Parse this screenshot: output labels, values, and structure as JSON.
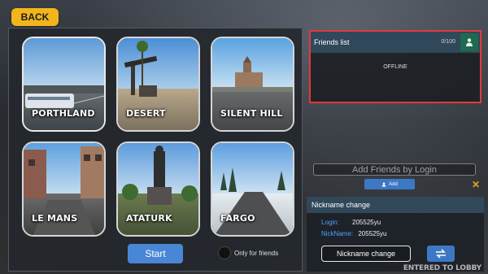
{
  "back_label": "BACK",
  "maps": [
    {
      "name": "PORTHLAND",
      "selected": true
    },
    {
      "name": "DESERT",
      "selected": false
    },
    {
      "name": "SILENT HILL",
      "selected": false
    },
    {
      "name": "LE MANS",
      "selected": false
    },
    {
      "name": "ATATURK",
      "selected": false
    },
    {
      "name": "FARGO",
      "selected": false
    }
  ],
  "start_label": "Start",
  "only_friends_label": "Only for friends",
  "friends": {
    "title": "Friends list",
    "count": "0/100",
    "icon": "add-friend-icon",
    "status": "OFFLINE"
  },
  "add_friends": {
    "placeholder": "Add Friends by Login",
    "add_label": "Add"
  },
  "nickname": {
    "title": "Nickname change",
    "login_key": "Login:",
    "login_value": "205525yu",
    "nick_key": "NickName:",
    "nick_value": "205525yu",
    "button_label": "Nickname change"
  },
  "status_text": "ENTERED TO LOBBY",
  "colors": {
    "accent_yellow": "#f2b51c",
    "button_blue": "#4a86d6",
    "highlight_red": "#e23a3a"
  }
}
